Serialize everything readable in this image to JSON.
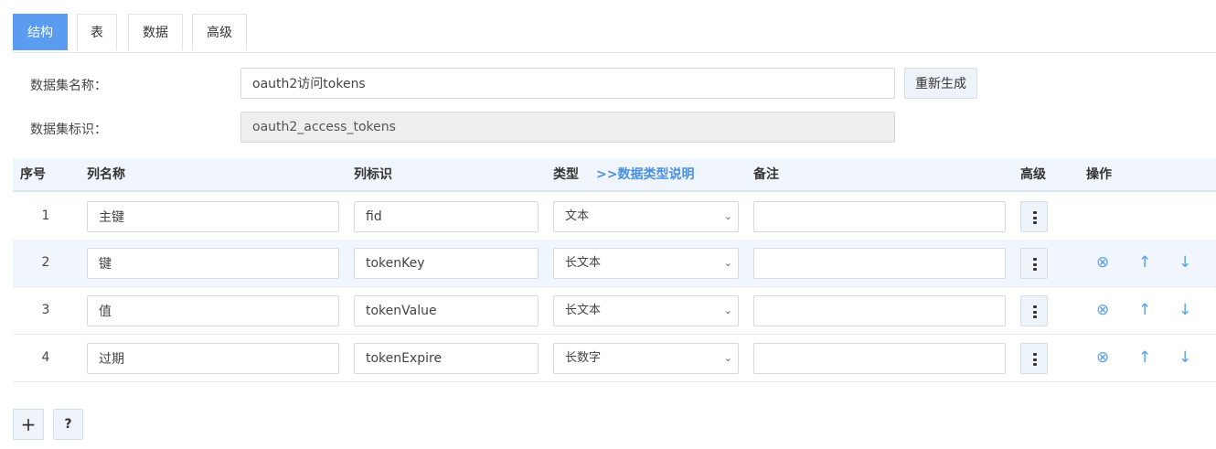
{
  "tabs": [
    "结构",
    "表",
    "数据",
    "高级"
  ],
  "active_tab": 0,
  "form": {
    "dataset_name_label": "数据集名称：",
    "dataset_name_value": "oauth2访问tokens",
    "regen_button": "重新生成",
    "dataset_id_label": "数据集标识：",
    "dataset_id_value": "oauth2_access_tokens"
  },
  "table": {
    "headers": {
      "seq": "序号",
      "col_name": "列名称",
      "col_id": "列标识",
      "type": "类型",
      "type_help_link": ">>数据类型说明",
      "note": "备注",
      "advanced": "高级",
      "actions": "操作"
    },
    "rows": [
      {
        "seq": "1",
        "name": "主键",
        "id": "fid",
        "type": "文本",
        "note": "",
        "ops": false
      },
      {
        "seq": "2",
        "name": "键",
        "id": "tokenKey",
        "type": "长文本",
        "note": "",
        "ops": true
      },
      {
        "seq": "3",
        "name": "值",
        "id": "tokenValue",
        "type": "长文本",
        "note": "",
        "ops": true
      },
      {
        "seq": "4",
        "name": "过期",
        "id": "tokenExpire",
        "type": "长数字",
        "note": "",
        "ops": true
      }
    ]
  },
  "icons": {
    "delete": "⊗",
    "up": "↑",
    "down": "↓",
    "chevron": "⌄",
    "add": "+",
    "help": "?"
  },
  "colors": {
    "accent": "#5b9bf0",
    "link": "#4a90e2",
    "icon": "#5aa0e8",
    "header_bg": "#f0f4fb",
    "alt_row_bg": "#f1f5fc"
  }
}
